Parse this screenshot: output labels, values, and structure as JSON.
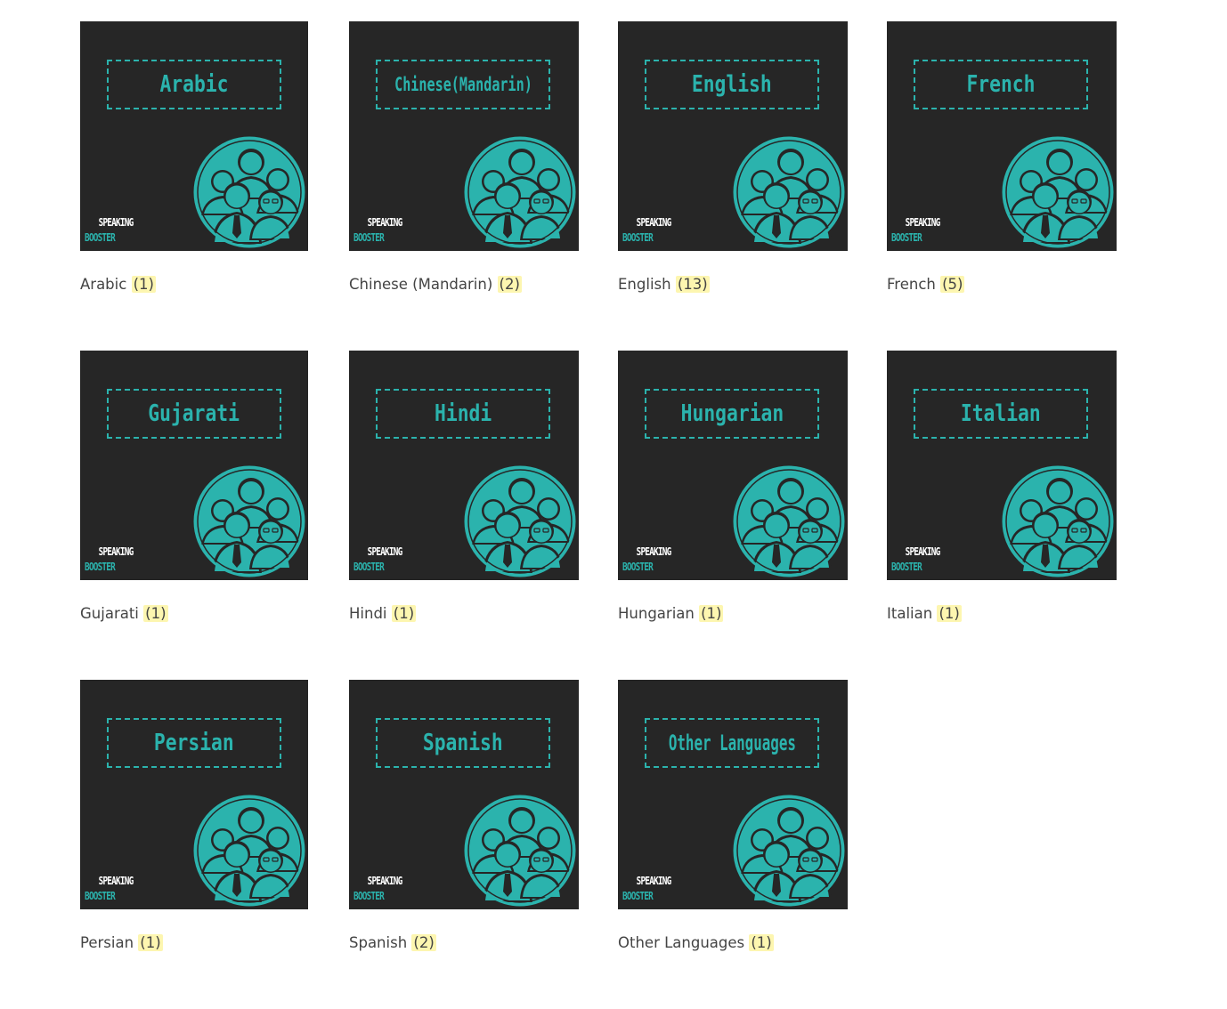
{
  "colors": {
    "background": "#ffffff",
    "tile_background": "#262626",
    "accent_teal": "#2bb3ad",
    "count_highlight": "#fdf6b0",
    "caption_text": "#444444"
  },
  "brand": {
    "line1": "SPEAKING",
    "line2": "BOOSTER"
  },
  "categories": [
    {
      "thumb_title": "Arabic",
      "label": "Arabic",
      "count": "(1)"
    },
    {
      "thumb_title": "Chinese(Mandarin)",
      "label": "Chinese (Mandarin)",
      "count": "(2)"
    },
    {
      "thumb_title": "English",
      "label": "English",
      "count": "(13)"
    },
    {
      "thumb_title": "French",
      "label": "French",
      "count": "(5)"
    },
    {
      "thumb_title": "Gujarati",
      "label": "Gujarati",
      "count": "(1)"
    },
    {
      "thumb_title": "Hindi",
      "label": "Hindi",
      "count": "(1)"
    },
    {
      "thumb_title": "Hungarian",
      "label": "Hungarian",
      "count": "(1)"
    },
    {
      "thumb_title": "Italian",
      "label": "Italian",
      "count": "(1)"
    },
    {
      "thumb_title": "Persian",
      "label": "Persian",
      "count": "(1)"
    },
    {
      "thumb_title": "Spanish",
      "label": "Spanish",
      "count": "(2)"
    },
    {
      "thumb_title": "Other Languages",
      "label": "Other Languages",
      "count": "(1)"
    }
  ]
}
